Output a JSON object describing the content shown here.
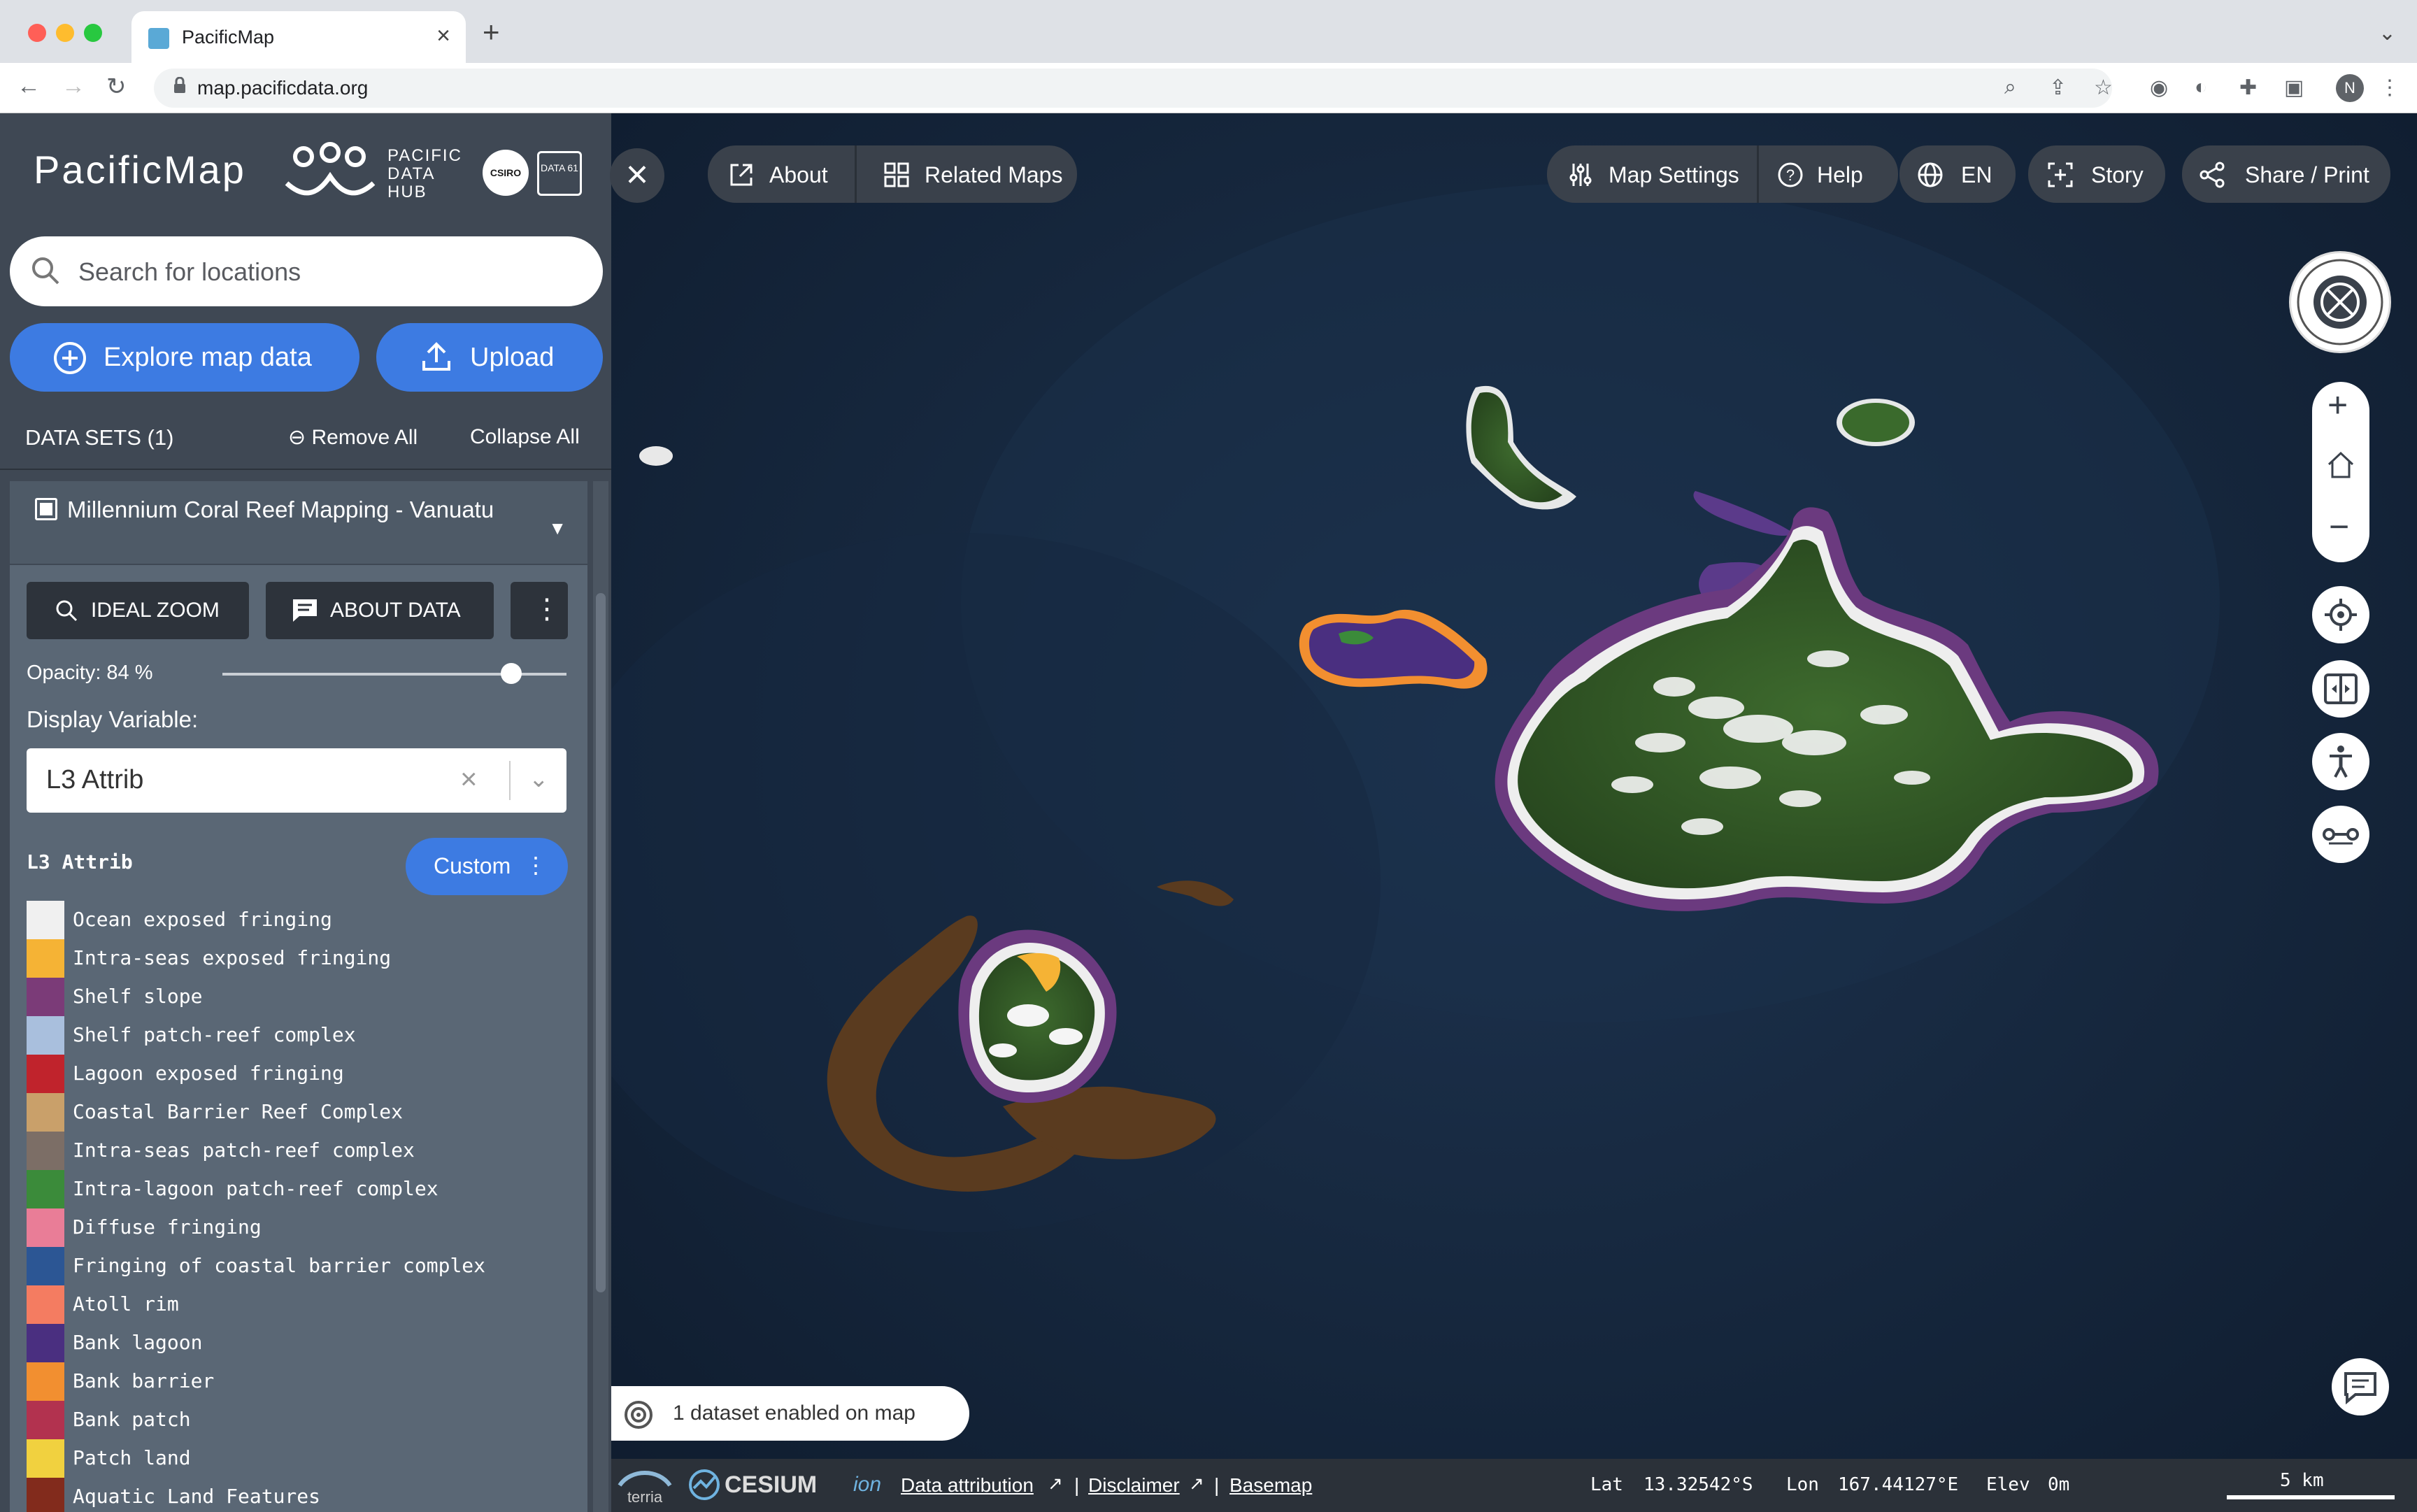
{
  "browser": {
    "tab_title": "PacificMap",
    "url": "map.pacificdata.org",
    "new_tab": "+",
    "profile_initial": "N"
  },
  "sidebar": {
    "brand": "PacificMap",
    "partner_logo_text": [
      "PACIFIC",
      "DATA",
      "HUB"
    ],
    "csiro_label": "CSIRO",
    "data61_label": "DATA 61",
    "search_placeholder": "Search for locations",
    "explore_button": "Explore map data",
    "upload_button": "Upload",
    "datasets_header": "DATA SETS (1)",
    "remove_all": "Remove All",
    "collapse_all": "Collapse All"
  },
  "dataset": {
    "title": "Millennium Coral Reef Mapping - Vanuatu",
    "ideal_zoom": "IDEAL ZOOM",
    "about_data": "ABOUT DATA",
    "opacity_label": "Opacity: 84 %",
    "opacity_value": 0.84,
    "display_variable_label": "Display Variable:",
    "display_variable_value": "L3 Attrib",
    "legend_title": "L3 Attrib",
    "custom_button": "Custom",
    "legend": [
      {
        "label": "Ocean exposed fringing",
        "color": "#f0f0f0"
      },
      {
        "label": "Intra-seas exposed fringing",
        "color": "#f5b335"
      },
      {
        "label": "Shelf slope",
        "color": "#7b3b78"
      },
      {
        "label": "Shelf patch-reef complex",
        "color": "#a9bfdd"
      },
      {
        "label": "Lagoon exposed fringing",
        "color": "#c0232c"
      },
      {
        "label": "Coastal Barrier Reef Complex",
        "color": "#c9a06a"
      },
      {
        "label": "Intra-seas patch-reef complex",
        "color": "#7c6e66"
      },
      {
        "label": "Intra-lagoon patch-reef complex",
        "color": "#3b8b3a"
      },
      {
        "label": "Diffuse fringing",
        "color": "#e97d97"
      },
      {
        "label": "Fringing of coastal barrier complex",
        "color": "#2c5694"
      },
      {
        "label": "Atoll rim",
        "color": "#f47c61"
      },
      {
        "label": "Bank lagoon",
        "color": "#4a2f80"
      },
      {
        "label": "Bank barrier",
        "color": "#f28f30"
      },
      {
        "label": "Bank patch",
        "color": "#b2324f"
      },
      {
        "label": "Patch land",
        "color": "#f1d13f"
      },
      {
        "label": "Aquatic Land Features",
        "color": "#822b1c"
      }
    ]
  },
  "map_toolbar": {
    "about": "About",
    "related_maps": "Related Maps",
    "map_settings": "Map Settings",
    "help": "Help",
    "language": "EN",
    "story": "Story",
    "share_print": "Share / Print"
  },
  "map": {
    "datasets_enabled": "1 dataset enabled on map",
    "terria_label": "terria",
    "cesium_label": "CESIUM",
    "ion_label": "ion",
    "data_attribution": "Data attribution",
    "disclaimer": "Disclaimer",
    "basemap": "Basemap",
    "separator": "|",
    "lat_label": "Lat",
    "lat_value": "13.32542°S",
    "lon_label": "Lon",
    "lon_value": "167.44127°E",
    "elev_label": "Elev",
    "elev_value": "0m",
    "scale": "5 km"
  }
}
